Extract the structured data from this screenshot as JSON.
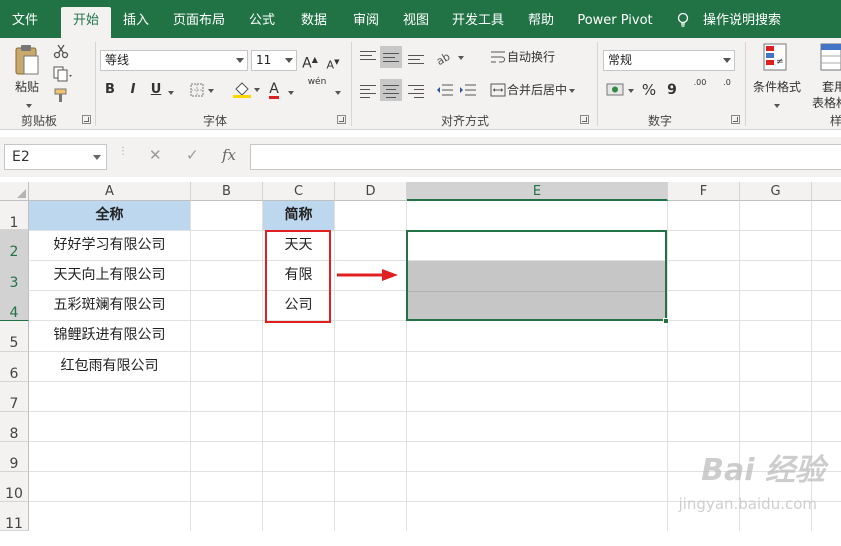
{
  "tabs": [
    "文件",
    "开始",
    "插入",
    "页面布局",
    "公式",
    "数据",
    "审阅",
    "视图",
    "开发工具",
    "帮助",
    "Power Pivot"
  ],
  "tell_me": "操作说明搜索",
  "ribbon": {
    "clipboard": {
      "paste": "粘贴",
      "label": "剪贴板"
    },
    "font": {
      "name": "等线",
      "size": "11",
      "grow": "A",
      "shrink": "A",
      "bold": "B",
      "italic": "I",
      "underline": "U",
      "font_color": "A",
      "phonetic": "wén",
      "label": "字体"
    },
    "alignment": {
      "wrap": "自动换行",
      "merge": "合并后居中",
      "label": "对齐方式"
    },
    "number": {
      "format": "常规",
      "percent": "%",
      "comma": "9",
      "inc_dec": ".00",
      "dec_dec": ".0",
      "label": "数字"
    },
    "styles": {
      "conditional": "条件格式",
      "table1": "套用",
      "table2": "表格格",
      "label_partial": "样"
    }
  },
  "formula_bar": {
    "name_box": "E2",
    "cancel": "✕",
    "enter": "✓",
    "fx": "fx",
    "content": ""
  },
  "columns": [
    "A",
    "B",
    "C",
    "D",
    "E",
    "F",
    "G"
  ],
  "rows": [
    "1",
    "2",
    "3",
    "4",
    "5",
    "6",
    "7",
    "8",
    "9",
    "10",
    "11"
  ],
  "cells": {
    "a1": "全称",
    "c1": "简称",
    "a2": "好好学习有限公司",
    "a3": "天天向上有限公司",
    "a4": "五彩斑斓有限公司",
    "a5": "锦鲤跃进有限公司",
    "a6": "红包雨有限公司",
    "c2": "天天",
    "c3": "有限",
    "c4": "公司"
  },
  "watermark": {
    "logo": "Bai 经验",
    "url": "jingyan.baidu.com"
  },
  "colors": {
    "excel_green": "#217346",
    "header_fill": "#bdd7ee",
    "annotation_red": "#e02020"
  }
}
